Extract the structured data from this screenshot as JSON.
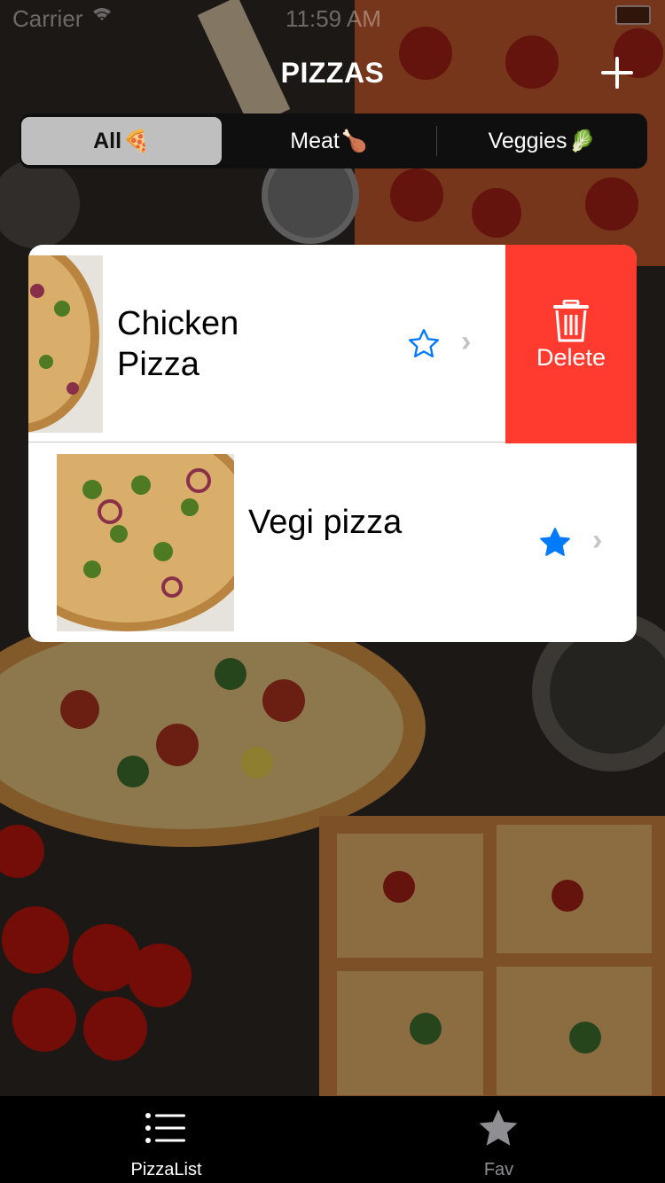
{
  "status_bar": {
    "carrier": "Carrier",
    "time": "11:59 AM"
  },
  "nav": {
    "title": "PIZZAS",
    "add_icon": "plus-icon"
  },
  "segments": [
    {
      "label": "All",
      "emoji": "🍕",
      "selected": true
    },
    {
      "label": "Meat",
      "emoji": "🍗",
      "selected": false
    },
    {
      "label": "Veggies",
      "emoji": "🥬",
      "selected": false
    }
  ],
  "pizzas": [
    {
      "name": "Chicken Pizza",
      "favorite": false,
      "swiped": true
    },
    {
      "name": "Vegi pizza",
      "favorite": true,
      "swiped": false
    }
  ],
  "delete_action": {
    "label": "Delete",
    "icon": "trash-icon"
  },
  "tabs": [
    {
      "label": "PizzaList",
      "icon": "list-icon",
      "selected": true
    },
    {
      "label": "Fav",
      "icon": "star-icon",
      "selected": false
    }
  ],
  "colors": {
    "accent": "#007aff",
    "delete": "#ff3b30",
    "segment_selected": "#bfbfbf",
    "tab_inactive": "#8e8e93"
  }
}
